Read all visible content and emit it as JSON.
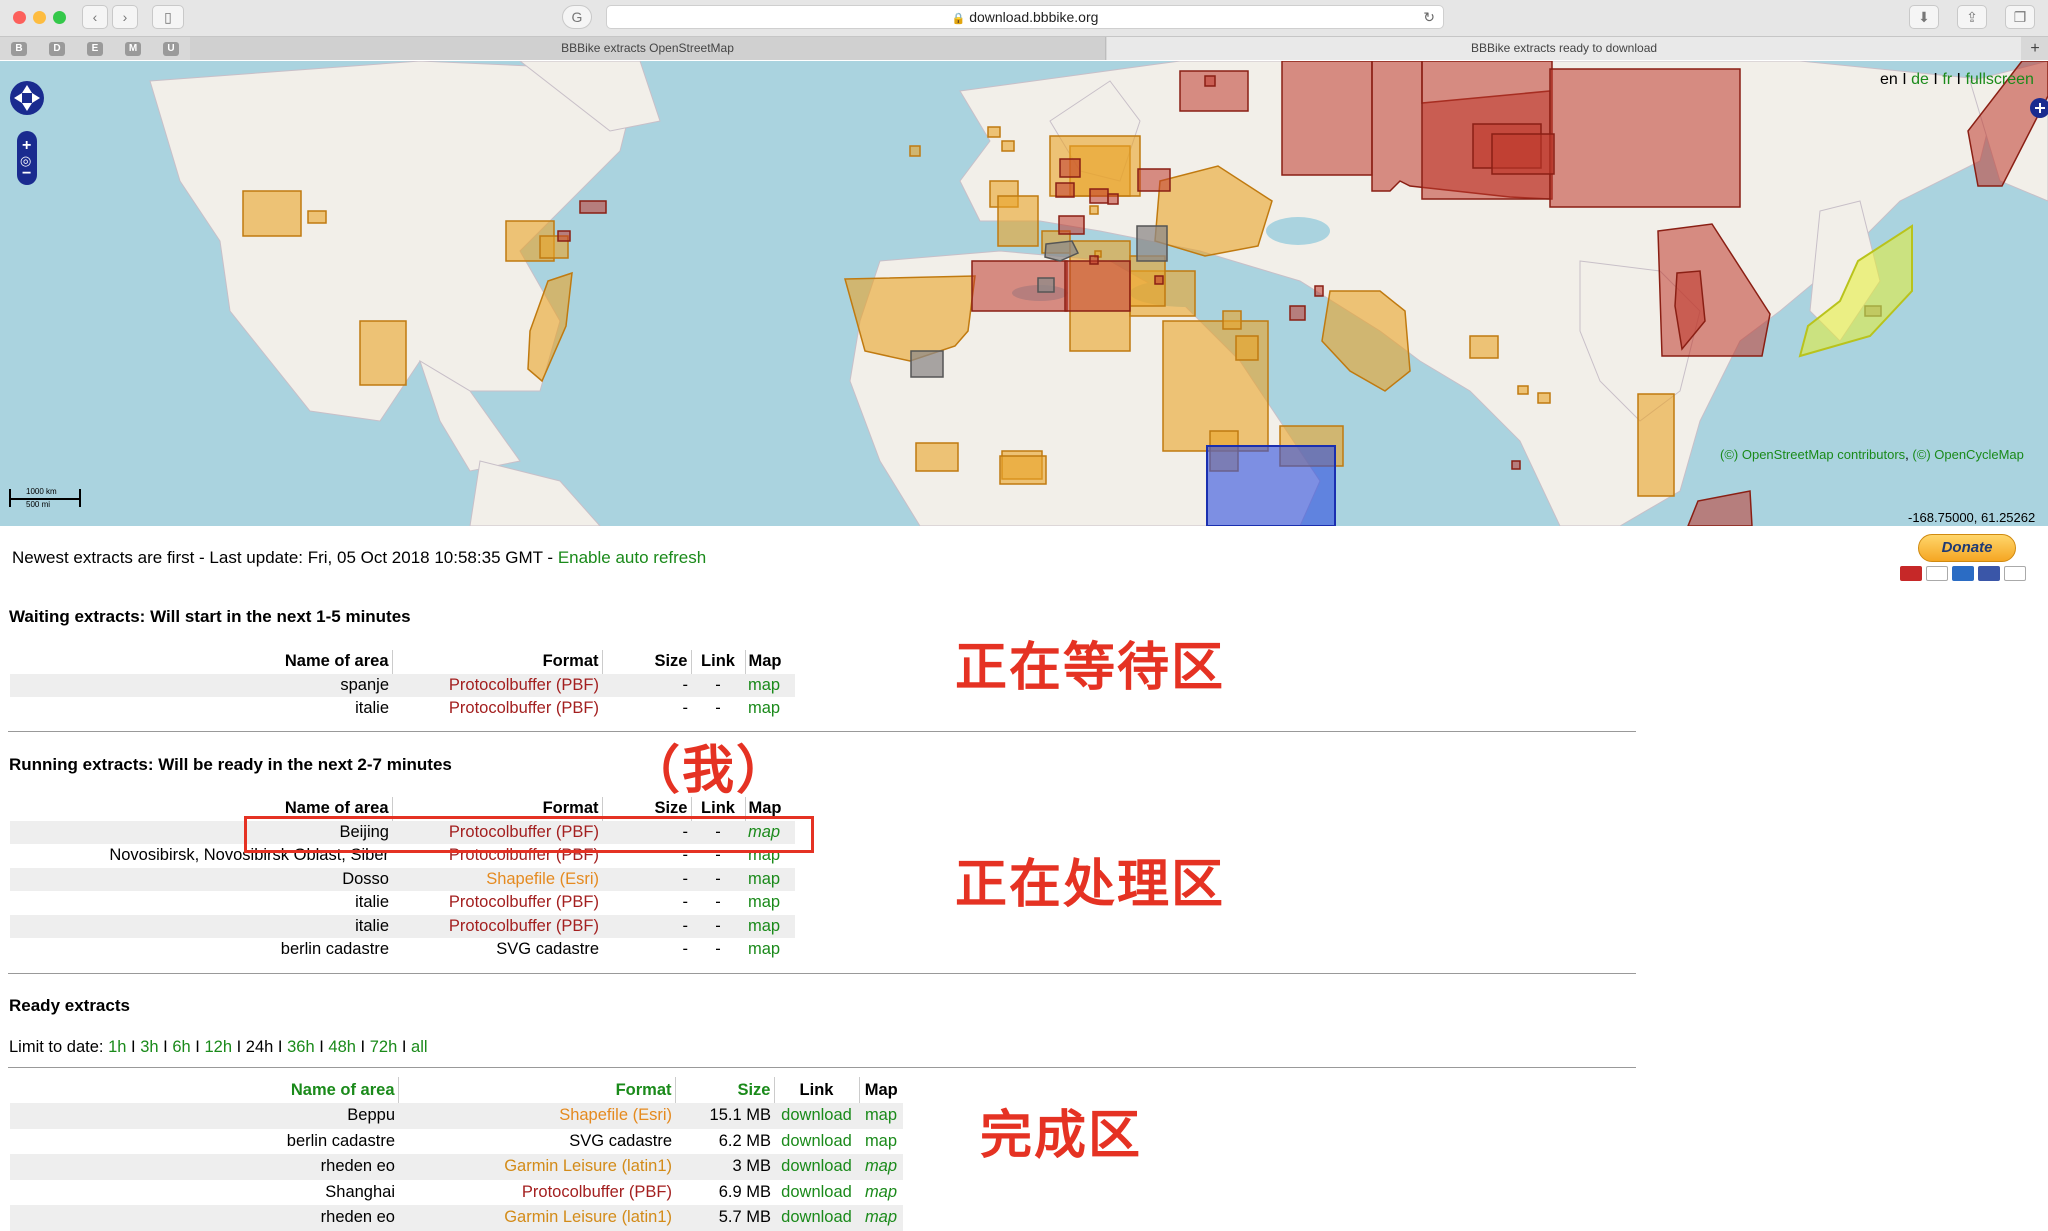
{
  "browser": {
    "url": "download.bbbike.org",
    "tabs": [
      {
        "title": "BBBike extracts OpenStreetMap"
      },
      {
        "title": "BBBike extracts ready to download"
      }
    ],
    "bookmarks": [
      "B",
      "D",
      "E",
      "M",
      "U"
    ],
    "new_tab": "+"
  },
  "map": {
    "lang_en": "en",
    "sep": "I",
    "lang_de": "de",
    "lang_fr": "fr",
    "fullscreen": "fullscreen",
    "attribution_osm": "(©) OpenStreetMap contributors",
    "attribution_sep": ",",
    "attribution_ocm": "(©) OpenCycleMap",
    "coords": "-168.75000, 61.25262",
    "scale_km": "1000 km",
    "scale_mi": "500 mi"
  },
  "status": {
    "text": "Newest extracts are first - Last update: Fri, 05 Oct 2018 10:58:35 GMT - ",
    "auto_refresh": "Enable auto refresh"
  },
  "donate": {
    "label": "Donate"
  },
  "columns": {
    "name": "Name of area",
    "format": "Format",
    "size": "Size",
    "link": "Link",
    "map": "Map"
  },
  "waiting": {
    "heading": "Waiting extracts: Will start in the next 1-5 minutes",
    "rows": [
      {
        "name": "spanje",
        "format": "Protocolbuffer (PBF)",
        "size": "-",
        "link": "-",
        "map": "map"
      },
      {
        "name": "italie",
        "format": "Protocolbuffer (PBF)",
        "size": "-",
        "link": "-",
        "map": "map"
      }
    ]
  },
  "running": {
    "heading": "Running extracts: Will be ready in the next 2-7 minutes",
    "rows": [
      {
        "name": "Beijing",
        "format": "Protocolbuffer (PBF)",
        "size": "-",
        "link": "-",
        "map": "map"
      },
      {
        "name": "Novosibirsk, Novosibirsk Oblast, Siber",
        "format": "Protocolbuffer (PBF)",
        "size": "-",
        "link": "-",
        "map": "map"
      },
      {
        "name": "Dosso",
        "format": "Shapefile (Esri)",
        "size": "-",
        "link": "-",
        "map": "map"
      },
      {
        "name": "italie",
        "format": "Protocolbuffer (PBF)",
        "size": "-",
        "link": "-",
        "map": "map"
      },
      {
        "name": "italie",
        "format": "Protocolbuffer (PBF)",
        "size": "-",
        "link": "-",
        "map": "map"
      },
      {
        "name": "berlin cadastre",
        "format": "SVG cadastre",
        "size": "-",
        "link": "-",
        "map": "map"
      }
    ]
  },
  "ready": {
    "heading": "Ready extracts",
    "limit_label": "Limit to date:",
    "limits": [
      "1h",
      "3h",
      "6h",
      "12h",
      "24h",
      "36h",
      "48h",
      "72h",
      "all"
    ],
    "limit_sep": "I",
    "rows": [
      {
        "name": "Beppu",
        "format": "Shapefile (Esri)",
        "size": "15.1 MB",
        "link": "download",
        "map": "map"
      },
      {
        "name": "berlin cadastre",
        "format": "SVG cadastre",
        "size": "6.2 MB",
        "link": "download",
        "map": "map"
      },
      {
        "name": "rheden eo",
        "format": "Garmin Leisure (latin1)",
        "size": "3 MB",
        "link": "download",
        "map": "map"
      },
      {
        "name": "Shanghai",
        "format": "Protocolbuffer (PBF)",
        "size": "6.9 MB",
        "link": "download",
        "map": "map"
      },
      {
        "name": "rheden eo",
        "format": "Garmin Leisure (latin1)",
        "size": "5.7 MB",
        "link": "download",
        "map": "map"
      }
    ]
  },
  "annotations": {
    "waiting": "正在等待区",
    "me": "（我）",
    "running": "正在处理区",
    "ready": "完成区"
  },
  "colors": {
    "link_green": "#1a8a1a",
    "pbf_red": "#a31f1f",
    "shapefile_orange": "#e58a1f",
    "annotation_red": "#e53223"
  }
}
